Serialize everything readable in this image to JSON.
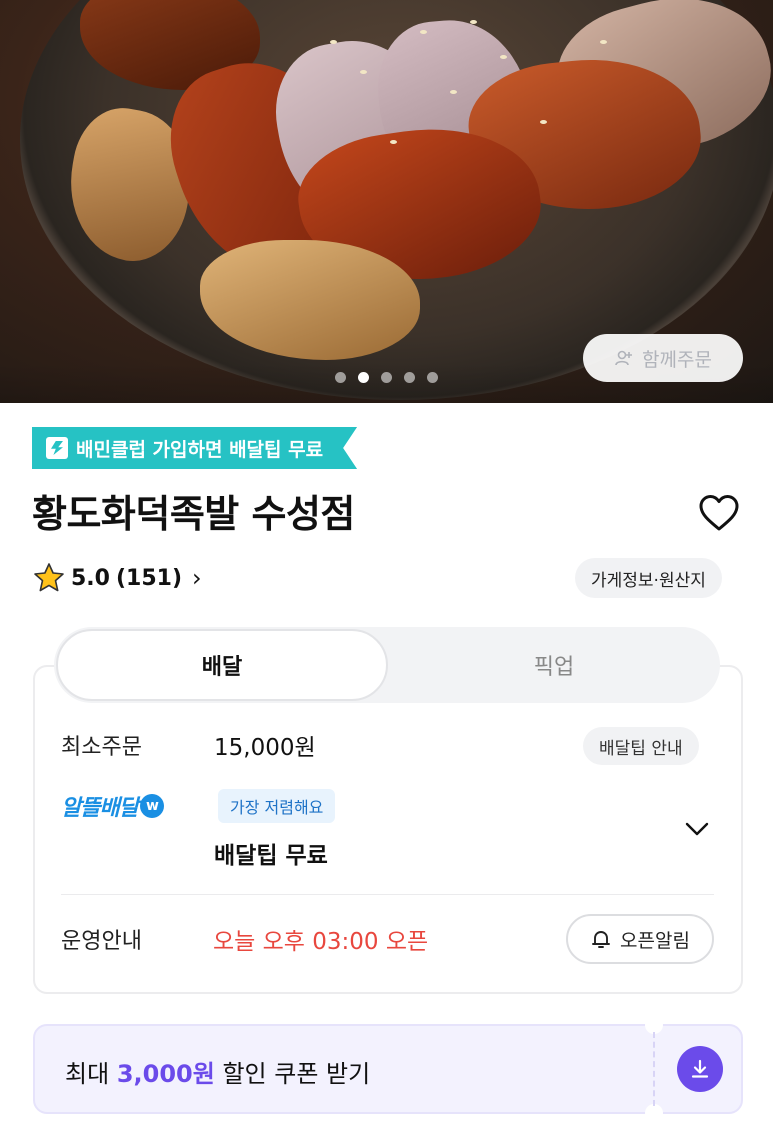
{
  "hero": {
    "image_subject": "jokbal-photo",
    "carousel_total": 5,
    "carousel_active_index": 1,
    "group_order_label": "함께주문"
  },
  "promo": {
    "label": "배민클럽 가입하면 배달팁 무료",
    "color": "#26c2c4"
  },
  "store": {
    "name": "황도화덕족발 수성점",
    "rating": "5.0",
    "review_count": "(151)",
    "info_chip": "가게정보·원산지"
  },
  "tabs": [
    {
      "label": "배달",
      "active": true
    },
    {
      "label": "픽업",
      "active": false
    }
  ],
  "delivery": {
    "min_order_label": "최소주문",
    "min_order_value": "15,000원",
    "tip_info_label": "배달팁 안내",
    "alddeul_brand": "알뜰배달",
    "cheapest_badge": "가장 저렴해요",
    "tip_value": "배달팁 무료",
    "operation_label": "운영안내",
    "open_time": "오늘 오후 03:00 오픈",
    "open_alarm_label": "오픈알림",
    "accent_red": "#e8473e",
    "brand_blue": "#1a8fe3"
  },
  "coupon": {
    "prefix": "최대",
    "amount": "3,000원",
    "suffix": "할인 쿠폰 받기",
    "accent": "#6b4bea"
  }
}
